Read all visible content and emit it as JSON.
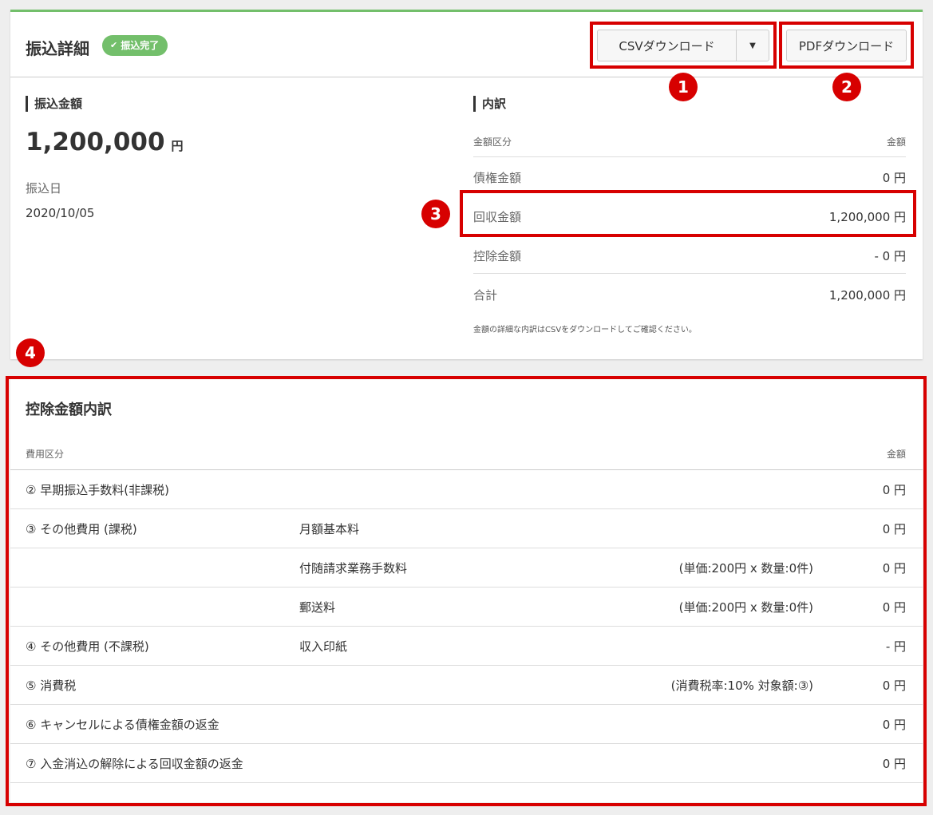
{
  "header": {
    "title": "振込詳細",
    "status_badge": "振込完了",
    "csv_button": "CSVダウンロード",
    "pdf_button": "PDFダウンロード"
  },
  "transfer": {
    "amount_label": "振込金額",
    "amount_value": "1,200,000",
    "amount_unit": "円",
    "date_label": "振込日",
    "date_value": "2020/10/05"
  },
  "breakdown": {
    "title": "内訳",
    "col_category": "金額区分",
    "col_amount": "金額",
    "rows": [
      {
        "label": "債権金額",
        "value": "0 円"
      },
      {
        "label": "回収金額",
        "value": "1,200,000 円"
      },
      {
        "label": "控除金額",
        "value": "- 0 円"
      },
      {
        "label": "合計",
        "value": "1,200,000 円"
      }
    ],
    "note": "金額の詳細な内訳はCSVをダウンロードしてご確認ください。"
  },
  "deduction": {
    "title": "控除金額内訳",
    "col_category": "費用区分",
    "col_amount": "金額",
    "rows": [
      {
        "category": "② 早期振込手数料(非課税)",
        "item": "",
        "detail": "",
        "amount": "0 円"
      },
      {
        "category": "③ その他費用 (課税)",
        "item": "月額基本料",
        "detail": "",
        "amount": "0 円"
      },
      {
        "category": "",
        "item": "付随請求業務手数料",
        "detail": "(単価:200円 x 数量:0件)",
        "amount": "0 円"
      },
      {
        "category": "",
        "item": "郵送料",
        "detail": "(単価:200円 x 数量:0件)",
        "amount": "0 円"
      },
      {
        "category": "④ その他費用 (不課税)",
        "item": "収入印紙",
        "detail": "",
        "amount": "- 円"
      },
      {
        "category": "⑤ 消費税",
        "item": "",
        "detail": "(消費税率:10% 対象額:③)",
        "amount": "0 円"
      },
      {
        "category": "⑥ キャンセルによる債権金額の返金",
        "item": "",
        "detail": "",
        "amount": "0 円"
      },
      {
        "category": "⑦ 入金消込の解除による回収金額の返金",
        "item": "",
        "detail": "",
        "amount": "0 円"
      }
    ]
  },
  "markers": [
    "1",
    "2",
    "3",
    "4"
  ],
  "colors": {
    "accent_green": "#73bf6b",
    "annotation_red": "#d70000"
  }
}
